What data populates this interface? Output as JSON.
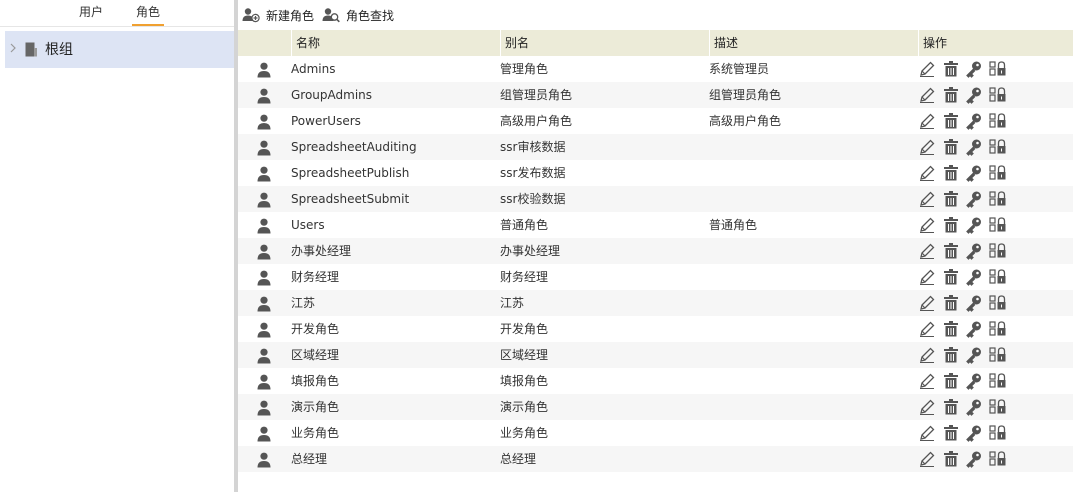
{
  "left_panel": {
    "tabs": [
      {
        "label": "用户"
      },
      {
        "label": "角色"
      }
    ],
    "tree": {
      "root_label": "根组"
    }
  },
  "toolbar": {
    "new_role_label": "新建角色",
    "find_role_label": "角色查找"
  },
  "table": {
    "columns": {
      "name": "名称",
      "alias": "别名",
      "description": "描述",
      "actions": "操作"
    },
    "rows": [
      {
        "name": "Admins",
        "alias": "管理角色",
        "description": "系统管理员"
      },
      {
        "name": "GroupAdmins",
        "alias": "组管理员角色",
        "description": "组管理员角色"
      },
      {
        "name": "PowerUsers",
        "alias": "高级用户角色",
        "description": "高级用户角色"
      },
      {
        "name": "SpreadsheetAuditing",
        "alias": "ssr审核数据",
        "description": ""
      },
      {
        "name": "SpreadsheetPublish",
        "alias": "ssr发布数据",
        "description": ""
      },
      {
        "name": "SpreadsheetSubmit",
        "alias": "ssr校验数据",
        "description": ""
      },
      {
        "name": "Users",
        "alias": "普通角色",
        "description": "普通角色"
      },
      {
        "name": "办事处经理",
        "alias": "办事处经理",
        "description": ""
      },
      {
        "name": "财务经理",
        "alias": "财务经理",
        "description": ""
      },
      {
        "name": "江苏",
        "alias": "江苏",
        "description": ""
      },
      {
        "name": "开发角色",
        "alias": "开发角色",
        "description": ""
      },
      {
        "name": "区域经理",
        "alias": "区域经理",
        "description": ""
      },
      {
        "name": "填报角色",
        "alias": "填报角色",
        "description": ""
      },
      {
        "name": "演示角色",
        "alias": "演示角色",
        "description": ""
      },
      {
        "name": "业务角色",
        "alias": "业务角色",
        "description": ""
      },
      {
        "name": "总经理",
        "alias": "总经理",
        "description": ""
      }
    ]
  },
  "icons": {
    "row_icon": "user-icon",
    "actions": [
      "pencil-icon",
      "trash-icon",
      "key-icon",
      "permission-icon"
    ]
  },
  "colors": {
    "tab_active_underline": "#f0a030",
    "tree_selected_bg": "#dde4f4",
    "header_bg": "#ecebd8",
    "alt_row_bg": "#f6f6f6",
    "icon_color": "#555555"
  }
}
